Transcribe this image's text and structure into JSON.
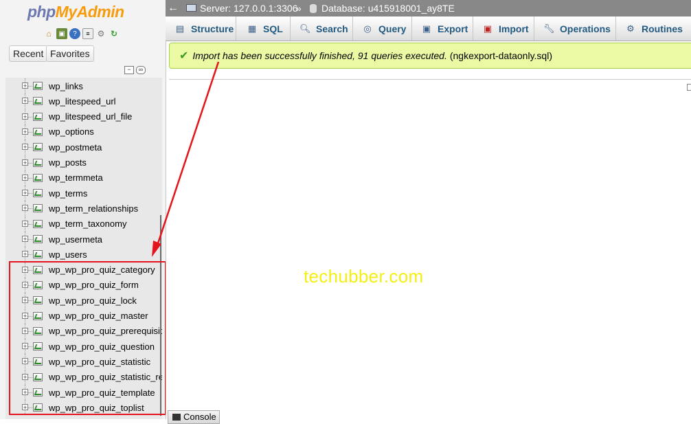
{
  "sidebar": {
    "logo_php": "php",
    "logo_myadmin": "MyAdmin",
    "recent_label": "Recent",
    "favorites_label": "Favorites",
    "nav_icons": [
      "home-icon",
      "logout-icon",
      "help-icon",
      "docs-icon",
      "settings-icon",
      "reload-icon"
    ],
    "tables": [
      "wp_links",
      "wp_litespeed_url",
      "wp_litespeed_url_file",
      "wp_options",
      "wp_postmeta",
      "wp_posts",
      "wp_termmeta",
      "wp_terms",
      "wp_term_relationships",
      "wp_term_taxonomy",
      "wp_usermeta",
      "wp_users",
      "wp_wp_pro_quiz_category",
      "wp_wp_pro_quiz_form",
      "wp_wp_pro_quiz_lock",
      "wp_wp_pro_quiz_master",
      "wp_wp_pro_quiz_prerequisite",
      "wp_wp_pro_quiz_question",
      "wp_wp_pro_quiz_statistic",
      "wp_wp_pro_quiz_statistic_ref",
      "wp_wp_pro_quiz_template",
      "wp_wp_pro_quiz_toplist"
    ]
  },
  "breadcrumb": {
    "back": "←",
    "server": "Server: 127.0.0.1:3306",
    "separator": "»",
    "database": "Database: u415918001_ay8TE"
  },
  "tabs": [
    {
      "label": "Structure",
      "icon": "structure-icon"
    },
    {
      "label": "SQL",
      "icon": "sql-icon"
    },
    {
      "label": "Search",
      "icon": "search-icon"
    },
    {
      "label": "Query",
      "icon": "query-icon"
    },
    {
      "label": "Export",
      "icon": "export-icon"
    },
    {
      "label": "Import",
      "icon": "import-icon"
    },
    {
      "label": "Operations",
      "icon": "wrench-icon"
    },
    {
      "label": "Routines",
      "icon": "routines-icon"
    }
  ],
  "message": {
    "text_italic": "Import has been successfully finished, 91 queries executed.",
    "text_file": "(ngkexport-dataonly.sql)",
    "status_color": "#ebf8a4"
  },
  "watermark": "techubber.com",
  "console": {
    "label": "Console"
  },
  "colors": {
    "annotation": "#e4141b",
    "watermark": "#f5ee12",
    "tab_text": "#235a81"
  }
}
